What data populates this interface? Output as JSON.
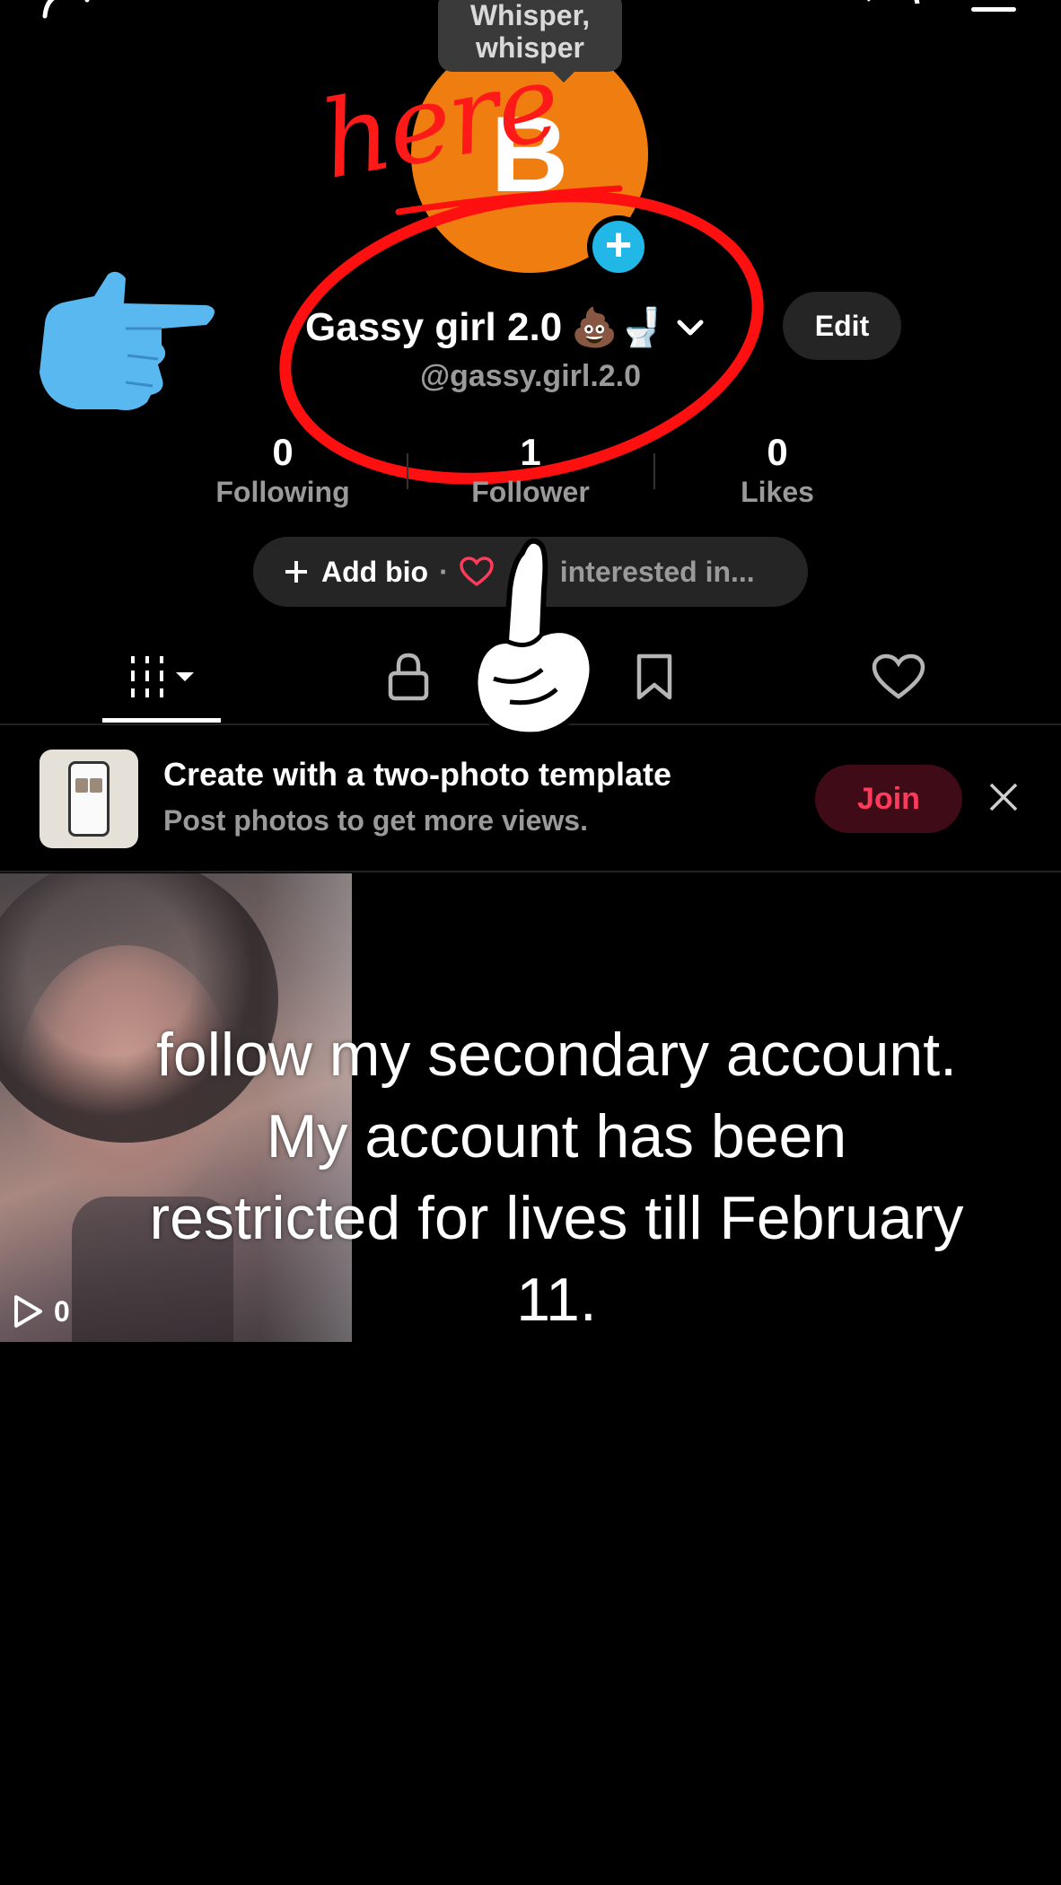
{
  "tooltip": {
    "line1": "Whisper,",
    "line2": "whisper"
  },
  "profile": {
    "avatar_letter": "B",
    "display_name": "Gassy girl 2.0",
    "display_emojis": "💩🚽",
    "username": "@gassy.girl.2.0",
    "edit_label": "Edit"
  },
  "stats": [
    {
      "value": "0",
      "label": "Following"
    },
    {
      "value": "1",
      "label": "Follower"
    },
    {
      "value": "0",
      "label": "Likes"
    }
  ],
  "bio": {
    "add_label": "Add bio",
    "separator": "·",
    "interested_label": "interested in..."
  },
  "promo": {
    "title": "Create with a two-photo template",
    "subtitle": "Post photos to get more views.",
    "button_label": "Join"
  },
  "video": {
    "views": "0"
  },
  "overlay": {
    "text": "follow my secondary account. My account has been restricted for lives till February 11."
  },
  "annotation": {
    "word": "here"
  },
  "colors": {
    "accent_red": "#ff3b5c",
    "avatar_orange": "#f07d10",
    "plus_blue": "#21b8e8",
    "ink_red": "#ff1010"
  }
}
